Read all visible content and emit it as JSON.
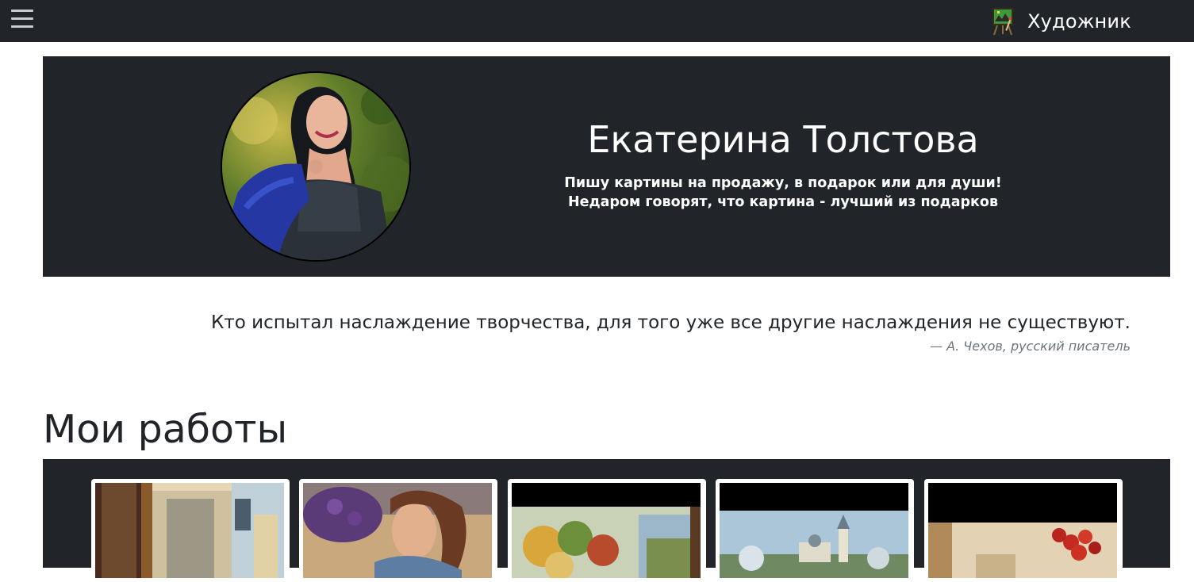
{
  "navbar": {
    "brand_text": "Художник",
    "menu_icon": "hamburger-menu-icon",
    "brand_icon": "easel-painting-icon"
  },
  "hero": {
    "name": "Екатерина Толстова",
    "subtitle_line1": "Пишу картины на продажу, в подарок или для души!",
    "subtitle_line2": "Недаром говорят, что картина - лучший из подарков"
  },
  "quote": {
    "text": "Кто испытал наслаждение творчества, для того уже все другие наслаждения не существуют.",
    "author": "— А. Чехов, русский писатель"
  },
  "works": {
    "title": "Мои работы"
  },
  "colors": {
    "dark": "#212529",
    "white": "#ffffff",
    "muted": "#6c757d"
  }
}
